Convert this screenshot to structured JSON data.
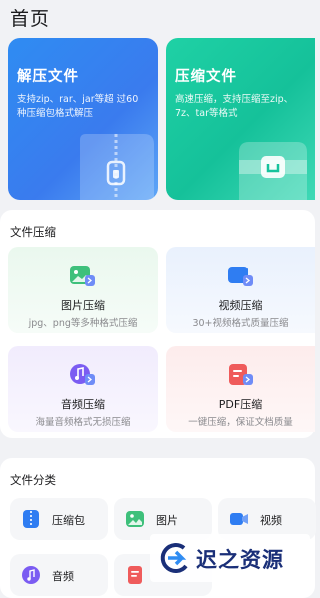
{
  "header": {
    "title": "首页"
  },
  "hero": {
    "extract": {
      "title": "解压文件",
      "desc": "支持zip、rar、jar等超 过60种压缩包格式解压"
    },
    "compress": {
      "title": "压缩文件",
      "desc": "高速压缩，支持压缩至zip、7z、tar等格式"
    }
  },
  "compress_section": {
    "title": "文件压缩",
    "tiles": [
      {
        "name": "图片压缩",
        "desc": "jpg、png等多种格式压缩",
        "icon": "image-compress-icon"
      },
      {
        "name": "视频压缩",
        "desc": "30+视频格式质量压缩",
        "icon": "video-compress-icon"
      },
      {
        "name": "音频压缩",
        "desc": "海量音频格式无损压缩",
        "icon": "audio-compress-icon"
      },
      {
        "name": "PDF压缩",
        "desc": "一键压缩，保证文档质量",
        "icon": "pdf-compress-icon"
      }
    ]
  },
  "category_section": {
    "title": "文件分类",
    "items": [
      {
        "label": "压缩包",
        "icon": "archive-icon"
      },
      {
        "label": "图片",
        "icon": "image-icon"
      },
      {
        "label": "视频",
        "icon": "video-icon"
      },
      {
        "label": "音频",
        "icon": "audio-icon"
      }
    ]
  },
  "watermark": {
    "text": "迟之资源"
  },
  "colors": {
    "blue": "#2f8cf2",
    "green": "#1fd1a5",
    "purple": "#7b5cf2",
    "red": "#ef5b5b"
  }
}
